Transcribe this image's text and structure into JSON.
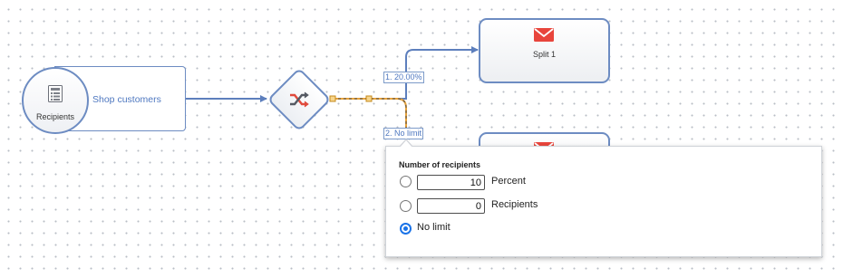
{
  "source": {
    "node_label": "Recipients",
    "segment_label": "Shop customers",
    "icon": "recipient-list-icon"
  },
  "split": {
    "icon": "shuffle-icon",
    "branches": [
      {
        "label": "1. 20.00%"
      },
      {
        "label": "2. No limit"
      }
    ]
  },
  "actions": [
    {
      "label": "Split 1",
      "icon": "mail-icon"
    },
    {
      "label": "",
      "icon": "mail-icon"
    }
  ],
  "popup": {
    "title": "Number of recipients",
    "options": [
      {
        "value": "10",
        "label": "Percent",
        "selected": false
      },
      {
        "value": "0",
        "label": "Recipients",
        "selected": false
      },
      {
        "label": "No limit",
        "selected": true
      }
    ]
  },
  "colors": {
    "accent": "#4f78c0",
    "node_border": "#6d8cc2",
    "selected_edge": "#e6a23c",
    "mail_red": "#e8453c",
    "radio_selected": "#1a73e8"
  }
}
